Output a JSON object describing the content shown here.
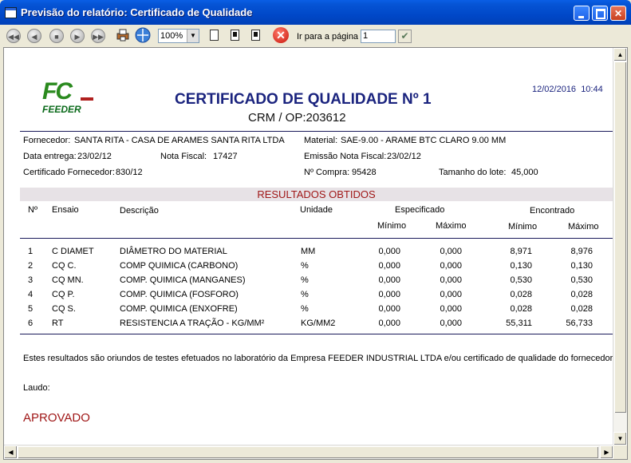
{
  "window": {
    "title": "Previsão do relatório: Certificado de Qualidade",
    "minimize_glyph": "",
    "maximize_glyph": "",
    "close_glyph": "✕"
  },
  "toolbar": {
    "zoom_value": "100%",
    "goto_label": "Ir para a página",
    "goto_value": "1"
  },
  "report": {
    "logo_text": "FC",
    "logo_name": "FEEDER",
    "title": "CERTIFICADO DE QUALIDADE Nº 1",
    "crm_label": "CRM / OP:",
    "crm_value": "203612",
    "date": "12/02/2016",
    "time": "10:44",
    "header": {
      "fornecedor_label": "Fornecedor:",
      "fornecedor_value": "SANTA RITA - CASA DE ARAMES SANTA RITA LTDA",
      "material_label": "Material:",
      "material_value": "SAE-9.00 - ARAME BTC CLARO 9.00 MM",
      "data_entrega_label": "Data entrega:",
      "data_entrega_value": "23/02/12",
      "nota_fiscal_label": "Nota Fiscal:",
      "nota_fiscal_value": "17427",
      "emissao_label": "Emissão Nota Fiscal:",
      "emissao_value": "23/02/12",
      "cert_fornecedor_label": "Certificado Fornecedor:",
      "cert_fornecedor_value": "830/12",
      "n_compra_label": "Nº Compra:",
      "n_compra_value": "95428",
      "lote_label": "Tamanho do lote:",
      "lote_value": "45,000"
    },
    "section_title": "RESULTADOS OBTIDOS",
    "columns": {
      "n": "Nº",
      "ensaio": "Ensaio",
      "descricao": "Descrição",
      "unidade": "Unidade",
      "especificado": "Especificado",
      "encontrado": "Encontrado",
      "minimo": "Mínimo",
      "maximo": "Máximo"
    },
    "rows": [
      {
        "n": "1",
        "ensaio": "C DIAMET",
        "descricao": "DIÂMETRO DO MATERIAL",
        "unidade": "MM",
        "esp_min": "0,000",
        "esp_max": "0,000",
        "enc_min": "8,971",
        "enc_max": "8,976"
      },
      {
        "n": "2",
        "ensaio": "CQ C.",
        "descricao": "COMP QUIMICA (CARBONO)",
        "unidade": "%",
        "esp_min": "0,000",
        "esp_max": "0,000",
        "enc_min": "0,130",
        "enc_max": "0,130"
      },
      {
        "n": "3",
        "ensaio": "CQ MN.",
        "descricao": "COMP. QUIMICA (MANGANES)",
        "unidade": "%",
        "esp_min": "0,000",
        "esp_max": "0,000",
        "enc_min": "0,530",
        "enc_max": "0,530"
      },
      {
        "n": "4",
        "ensaio": "CQ P.",
        "descricao": "COMP. QUIMICA (FOSFORO)",
        "unidade": "%",
        "esp_min": "0,000",
        "esp_max": "0,000",
        "enc_min": "0,028",
        "enc_max": "0,028"
      },
      {
        "n": "5",
        "ensaio": "CQ S.",
        "descricao": "COMP. QUIMICA (ENXOFRE)",
        "unidade": "%",
        "esp_min": "0,000",
        "esp_max": "0,000",
        "enc_min": "0,028",
        "enc_max": "0,028"
      },
      {
        "n": "6",
        "ensaio": "RT",
        "descricao": "RESISTENCIA A TRAÇÃO - KG/MM²",
        "unidade": "KG/MM2",
        "esp_min": "0,000",
        "esp_max": "0,000",
        "enc_min": "55,311",
        "enc_max": "56,733"
      }
    ],
    "footer_note": "Estes resultados são oriundos de testes efetuados no laboratório da Empresa FEEDER INDUSTRIAL LTDA e/ou certificado de qualidade do fornecedor.",
    "laudo_label": "Laudo:",
    "laudo_value": "APROVADO"
  }
}
